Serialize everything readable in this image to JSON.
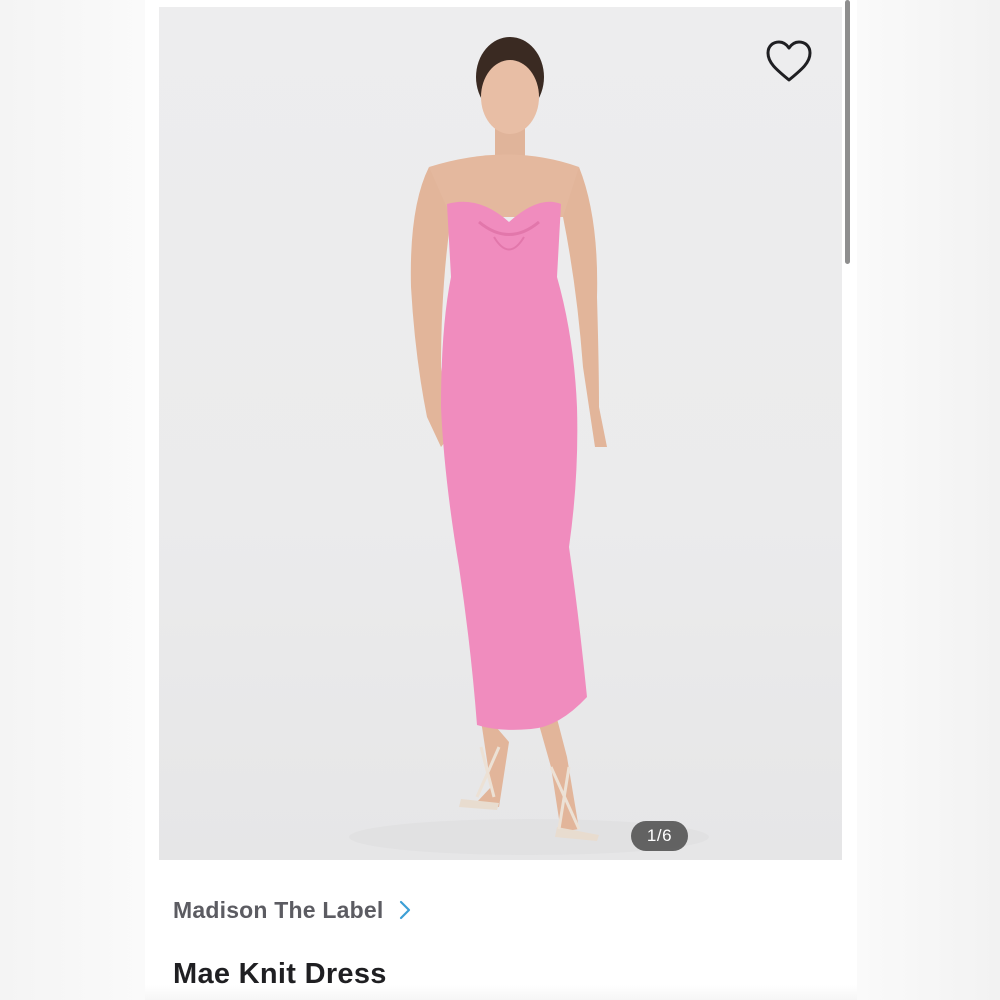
{
  "gallery": {
    "counter": "1/6",
    "favorite_icon": "heart-outline-icon"
  },
  "product": {
    "brand": "Madison The Label",
    "brand_chevron_icon": "chevron-right-icon",
    "title": "Mae Knit Dress"
  },
  "colors": {
    "dress": "#f08cbe",
    "brand_text": "#5c5c62",
    "chevron": "#3d9fd6",
    "title_text": "#1f1f22"
  }
}
